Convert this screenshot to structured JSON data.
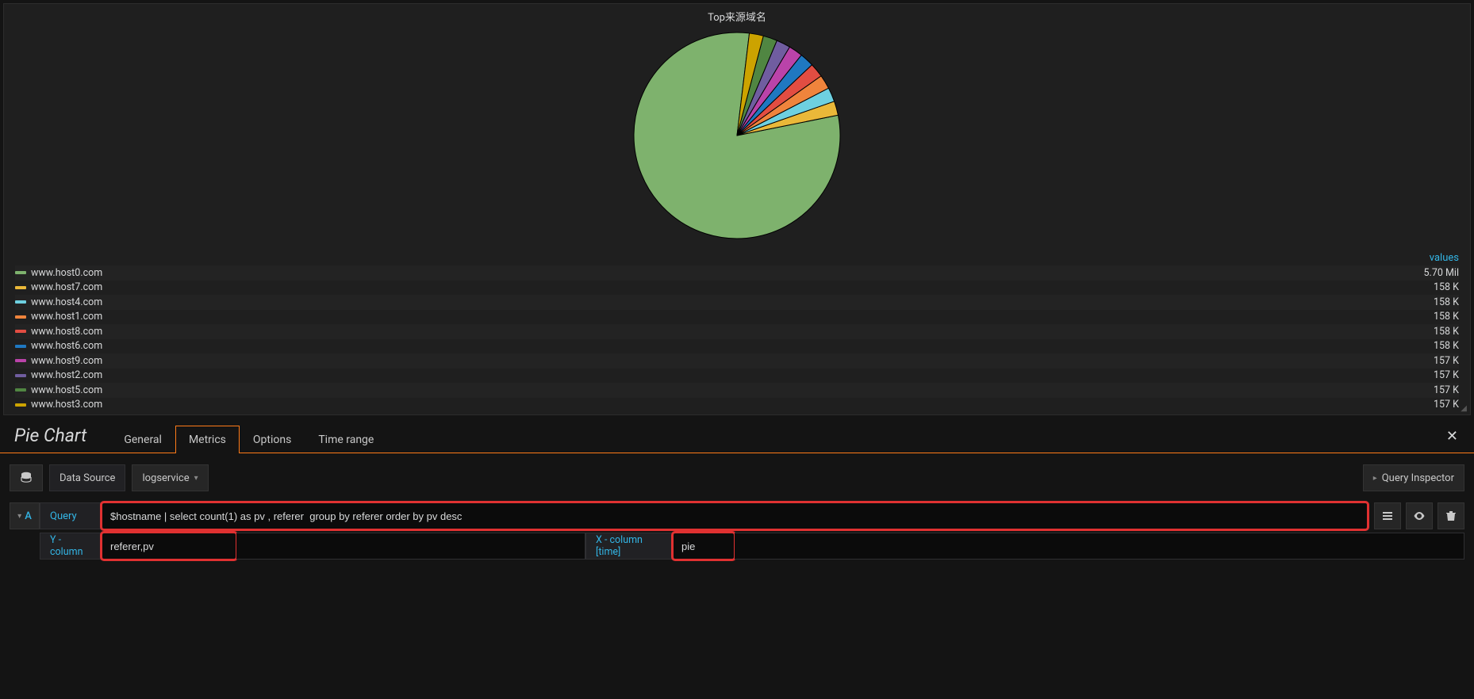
{
  "chart": {
    "title": "Top来源域名",
    "values_header": "values",
    "legend": [
      {
        "label": "www.host0.com",
        "color": "#7eb26d",
        "value": "5.70 Mil"
      },
      {
        "label": "www.host7.com",
        "color": "#eab839",
        "value": "158 K"
      },
      {
        "label": "www.host4.com",
        "color": "#6ed0e0",
        "value": "158 K"
      },
      {
        "label": "www.host1.com",
        "color": "#ef843c",
        "value": "158 K"
      },
      {
        "label": "www.host8.com",
        "color": "#e24d42",
        "value": "158 K"
      },
      {
        "label": "www.host6.com",
        "color": "#1f78c1",
        "value": "158 K"
      },
      {
        "label": "www.host9.com",
        "color": "#ba43a9",
        "value": "157 K"
      },
      {
        "label": "www.host2.com",
        "color": "#705da0",
        "value": "157 K"
      },
      {
        "label": "www.host5.com",
        "color": "#508642",
        "value": "157 K"
      },
      {
        "label": "www.host3.com",
        "color": "#cca300",
        "value": "157 K"
      }
    ]
  },
  "chart_data": {
    "type": "pie",
    "title": "Top来源域名",
    "series": [
      {
        "name": "www.host0.com",
        "value": 5700000,
        "display": "5.70 Mil",
        "color": "#7eb26d"
      },
      {
        "name": "www.host7.com",
        "value": 158000,
        "display": "158 K",
        "color": "#eab839"
      },
      {
        "name": "www.host4.com",
        "value": 158000,
        "display": "158 K",
        "color": "#6ed0e0"
      },
      {
        "name": "www.host1.com",
        "value": 158000,
        "display": "158 K",
        "color": "#ef843c"
      },
      {
        "name": "www.host8.com",
        "value": 158000,
        "display": "158 K",
        "color": "#e24d42"
      },
      {
        "name": "www.host6.com",
        "value": 158000,
        "display": "158 K",
        "color": "#1f78c1"
      },
      {
        "name": "www.host9.com",
        "value": 157000,
        "display": "157 K",
        "color": "#ba43a9"
      },
      {
        "name": "www.host2.com",
        "value": 157000,
        "display": "157 K",
        "color": "#705da0"
      },
      {
        "name": "www.host5.com",
        "value": 157000,
        "display": "157 K",
        "color": "#508642"
      },
      {
        "name": "www.host3.com",
        "value": 157000,
        "display": "157 K",
        "color": "#cca300"
      }
    ]
  },
  "editor": {
    "panel_type": "Pie Chart",
    "tabs": {
      "general": "General",
      "metrics": "Metrics",
      "options": "Options",
      "timerange": "Time range",
      "active": "Metrics"
    },
    "datasource_label": "Data Source",
    "datasource_value": "logservice",
    "inspector_label": "Query Inspector",
    "query": {
      "letter": "A",
      "label": "Query",
      "value": "$hostname | select count(1) as pv , referer  group by referer order by pv desc",
      "ycol_label": "Y - column",
      "ycol_value": "referer,pv",
      "xcol_label": "X - column [time]",
      "xcol_value": "pie"
    }
  }
}
